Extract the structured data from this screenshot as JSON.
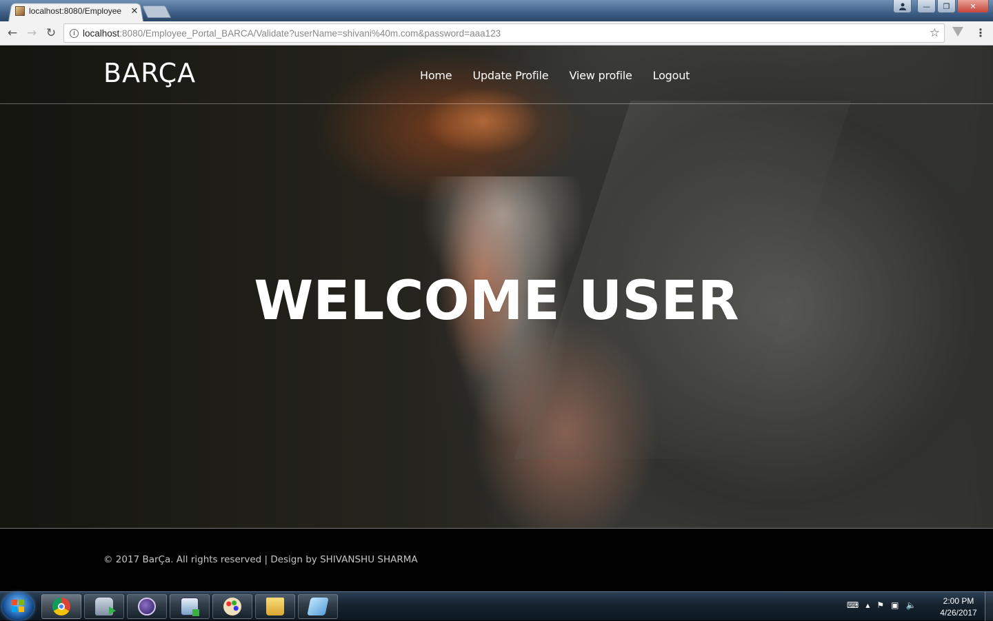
{
  "browser": {
    "tab_title": "localhost:8080/Employee",
    "tab_close": "✕",
    "url_host": "localhost",
    "url_rest": ":8080/Employee_Portal_BARCA/Validate?userName=shivani%40m.com&password=aaa123",
    "back_icon": "←",
    "forward_icon": "→",
    "reload_icon": "↻",
    "star_icon": "☆",
    "menu_icon": "⋮",
    "info_icon": "i",
    "win_minimize": "—",
    "win_maximize": "❐",
    "win_close": "✕"
  },
  "site": {
    "brand": "BARÇA",
    "nav": [
      "Home",
      "Update Profile",
      "View profile",
      "Logout"
    ],
    "hero_heading": "WELCOME USER",
    "footer": "© 2017 BarÇa. All rights reserved | Design by SHIVANSHU SHARMA"
  },
  "taskbar": {
    "time": "2:00 PM",
    "date": "4/26/2017",
    "apps": [
      "chrome-icon",
      "database-icon",
      "eclipse-icon",
      "ide-icon",
      "paint-icon",
      "explorer-icon",
      "notepad-icon"
    ]
  }
}
